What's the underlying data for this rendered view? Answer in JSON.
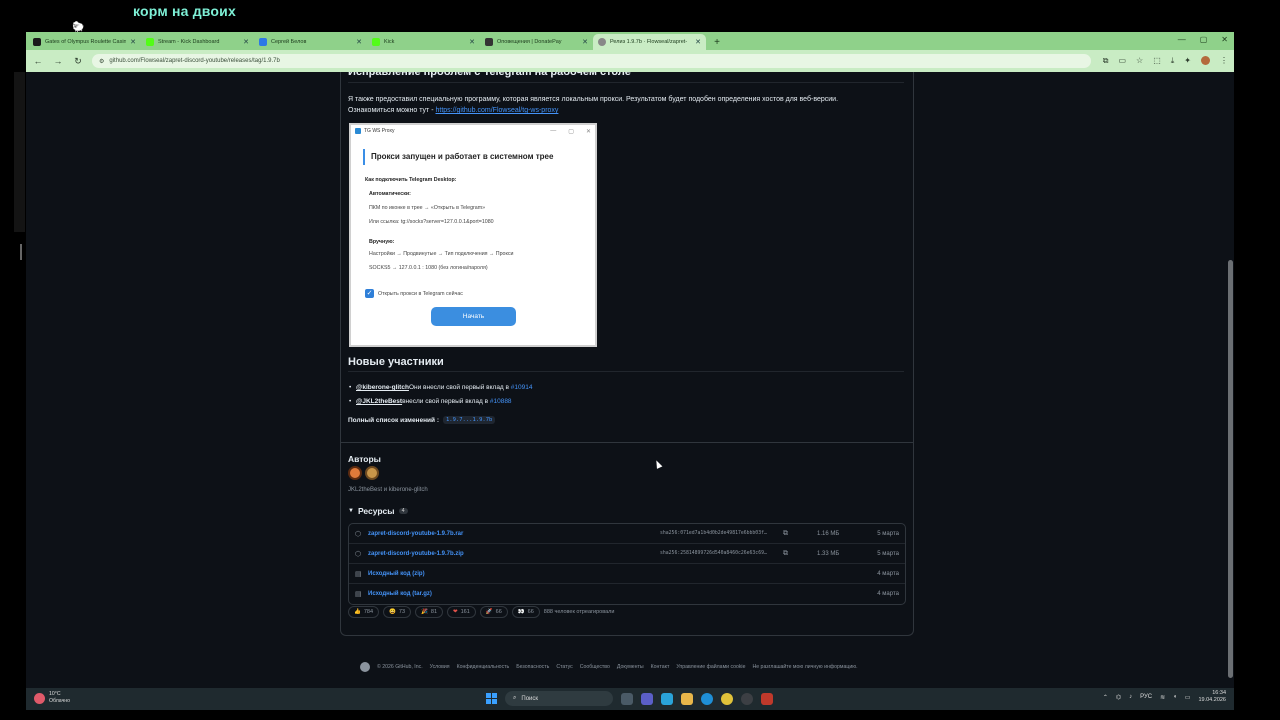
{
  "overlay": {
    "title": "корм на двоих"
  },
  "browser": {
    "tabs": [
      {
        "label": "Gates of Olympus Roulette Casino",
        "color": "#1a1a1a"
      },
      {
        "label": "Stream - Kick Dashboard",
        "color": "#53fc18"
      },
      {
        "label": "Сергей Белов",
        "color": "#2d78e6"
      },
      {
        "label": "Kick",
        "color": "#53fc18"
      },
      {
        "label": "Оповещения | DonatePay",
        "color": "#333333"
      },
      {
        "label": "Релиз 1.9.7b · Flowseal/zapret-",
        "color": "#888888"
      }
    ],
    "new_tab": "+",
    "url": "github.com/Flowseal/zapret-discord-youtube/releases/tag/1.9.7b"
  },
  "release": {
    "telegram_heading": "Исправление проблем с Telegram на рабочем столе",
    "telegram_text": "Я также предоставил специальную программу, которая является локальным прокси. Результатом будет подобен определения хостов для веб-версии.",
    "telegram_text2": "Ознакомиться можно тут - ",
    "telegram_link": "https://github.com/Flowseal/tg-ws-proxy",
    "proxy_window": {
      "title": "TG WS Proxy",
      "heading": "Прокси запущен и работает в системном трее",
      "how_to": "Как подключить Telegram Desktop:",
      "auto": "Автоматически:",
      "auto_1": "ПКМ по иконке в трее → «Открыть в Telegram»",
      "auto_2": "Или ссылка: tg://socks?server=127.0.0.1&port=1080",
      "manual": "Вручную:",
      "manual_1": "Настройки → Продвинутые → Тип подключения → Прокси",
      "manual_2": "SOCKS5 → 127.0.0.1 : 1080 (без логина/пароля)",
      "checkbox": "Открыть прокси в Telegram сейчас",
      "button": "Начать"
    },
    "new_contributors_heading": "Новые участники",
    "contributors": [
      {
        "user": "@kiberone-glitch",
        "text": "Они внесли свой первый вклад в ",
        "pr": "#10914"
      },
      {
        "user": "@JKL2theBest",
        "text": "внесли свой первый вклад в ",
        "pr": "#10888"
      }
    ],
    "full_changelog_label": "Полный список изменений :",
    "full_changelog_value": "1.9.7...1.9.7b",
    "authors_heading": "Авторы",
    "authors_names": "JKL2theBest и kiberone-glitch",
    "assets_heading": "Ресурсы",
    "assets_count": "4",
    "assets": [
      {
        "name": "zapret-discord-youtube-1.9.7b.rar",
        "sha": "sha256:071ed7a1b4d0b2de49817e6bbb03f…",
        "size": "1.16 МБ",
        "date": "5 марта"
      },
      {
        "name": "zapret-discord-youtube-1.9.7b.zip",
        "sha": "sha256:25814899726d540a8460c26e63c69…",
        "size": "1.33 МБ",
        "date": "5 марта"
      },
      {
        "name": "Исходный код (zip)",
        "sha": "",
        "size": "",
        "date": "4 марта"
      },
      {
        "name": "Исходный код (tar.gz)",
        "sha": "",
        "size": "",
        "date": "4 марта"
      }
    ],
    "reactions": [
      {
        "emoji": "👍",
        "count": "784"
      },
      {
        "emoji": "😄",
        "count": "73"
      },
      {
        "emoji": "🎉",
        "count": "81"
      },
      {
        "emoji": "❤",
        "count": "161"
      },
      {
        "emoji": "🚀",
        "count": "66"
      },
      {
        "emoji": "👀",
        "count": "66"
      }
    ],
    "reactions_summary": "888 человек отреагировали"
  },
  "footer": {
    "links": [
      "© 2026 GitHub, Inc.",
      "Условия",
      "Конфиденциальность",
      "Безопасность",
      "Статус",
      "Сообщество",
      "Документы",
      "Контакт",
      "Управление файлами cookie",
      "Не разглашайте мою личную информацию."
    ]
  },
  "taskbar": {
    "weather_temp": "10°C",
    "weather_desc": "Облачно",
    "search": "Поиск",
    "lang": "РУС",
    "time": "16:34",
    "date": "19.04.2026"
  }
}
